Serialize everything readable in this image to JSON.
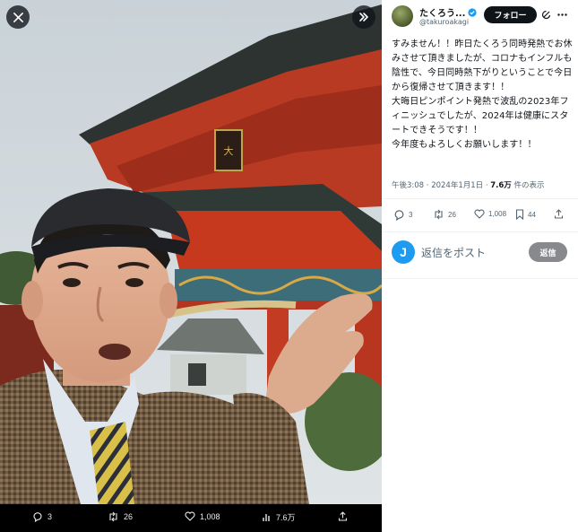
{
  "media": {
    "close_icon": "close-icon",
    "expand_icon": "chevron-double-right-icon",
    "stats": {
      "replies": "3",
      "reposts": "26",
      "likes": "1,008",
      "views": "7.6万"
    }
  },
  "tweet": {
    "display_name": "たくろう...",
    "verified_color": "#1d9bf0",
    "handle": "@takuroakagi",
    "follow_label": "フォロー",
    "text": "すみません！！昨日たくろう同時発熱でお休みさせて頂きましたが、コロナもインフルも陰性で、今日同時熱下がりということで今日から復帰させて頂きます！！\n大晦日ピンポイント発熱で波乱の2023年フィニッシュでしたが、2024年は健康にスタートできそうです！！\n今年度もよろしくお願いします！！",
    "time": "午後3:08 · 2024年1月1日 · ",
    "views_count": "7.6万",
    "views_suffix": " 件の表示",
    "actions": {
      "replies": "3",
      "reposts": "26",
      "likes": "1,008",
      "bookmarks": "44"
    }
  },
  "reply": {
    "avatar_letter": "J",
    "placeholder": "返信をポスト",
    "button_label": "返信"
  }
}
